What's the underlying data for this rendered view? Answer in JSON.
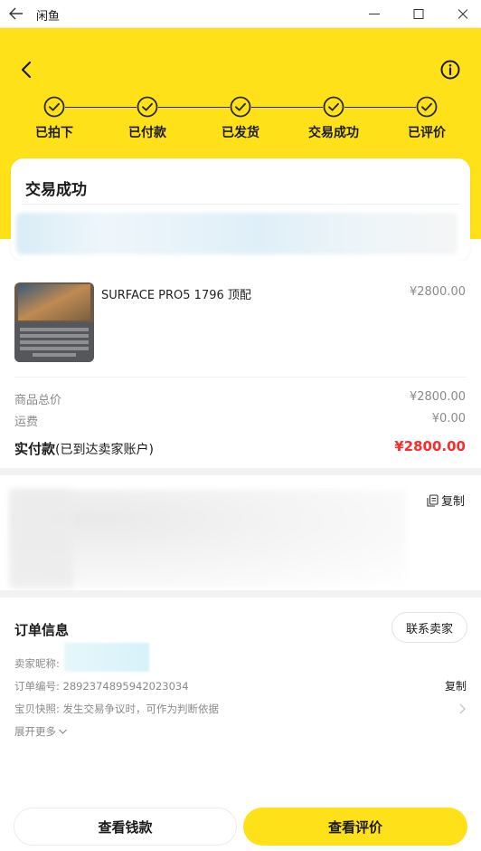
{
  "window": {
    "title": "闲鱼"
  },
  "progress": {
    "steps": [
      {
        "label": "已拍下"
      },
      {
        "label": "已付款"
      },
      {
        "label": "已发货"
      },
      {
        "label": "交易成功"
      },
      {
        "label": "已评价"
      }
    ],
    "completed_steps": 5
  },
  "status": {
    "title": "交易成功"
  },
  "product": {
    "name": "SURFACE PRO5 1796 顶配",
    "price": "¥2800.00"
  },
  "summary": {
    "total_label": "商品总价",
    "total_value": "¥2800.00",
    "shipping_label": "运费",
    "shipping_value": "¥0.00",
    "paid_label": "实付款",
    "paid_note": "(已到达卖家账户)",
    "paid_value": "¥2800.00"
  },
  "address": {
    "copy_label": "复制"
  },
  "order": {
    "title": "订单信息",
    "contact_button": "联系卖家",
    "seller_nick_label": "卖家昵称:",
    "order_no_label": "订单编号:",
    "order_no_value": "2892374895942023034",
    "copy_label": "复制",
    "snapshot_label": "宝贝快照:",
    "snapshot_value": "发生交易争议时，可作为判断依据",
    "expand_label": "展开更多"
  },
  "actions": {
    "view_money": "查看钱款",
    "view_review": "查看评价"
  },
  "colors": {
    "brand_yellow": "#ffe11a",
    "price_red": "#ff2a2a",
    "muted_text": "#8a8a8a"
  },
  "icons": {
    "back": "arrow-left-icon",
    "info": "info-circle-icon",
    "step": "check-circle-icon",
    "copy": "copy-icon",
    "expand": "chevron-down-icon",
    "snapshot": "chevron-right-icon"
  }
}
